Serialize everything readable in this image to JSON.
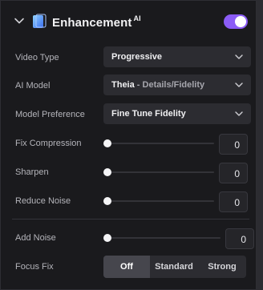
{
  "header": {
    "title": "Enhancement",
    "badge": "AI",
    "toggle_on": true
  },
  "rows": {
    "video_type": {
      "label": "Video Type",
      "value": "Progressive"
    },
    "ai_model": {
      "label": "AI Model",
      "value": "Theia",
      "value_sub": " - Details/Fidelity"
    },
    "model_preference": {
      "label": "Model Preference",
      "value": "Fine Tune Fidelity"
    },
    "fix_compression": {
      "label": "Fix Compression",
      "value": "0"
    },
    "sharpen": {
      "label": "Sharpen",
      "value": "0"
    },
    "reduce_noise": {
      "label": "Reduce Noise",
      "value": "0"
    },
    "add_noise": {
      "label": "Add Noise",
      "value": "0"
    },
    "focus_fix": {
      "label": "Focus Fix",
      "options": [
        "Off",
        "Standard",
        "Strong"
      ],
      "selected": "Off"
    }
  },
  "colors": {
    "accent": "#8b5cf6",
    "panel_bg": "#1a1a1d",
    "control_bg": "#2c2c31"
  }
}
